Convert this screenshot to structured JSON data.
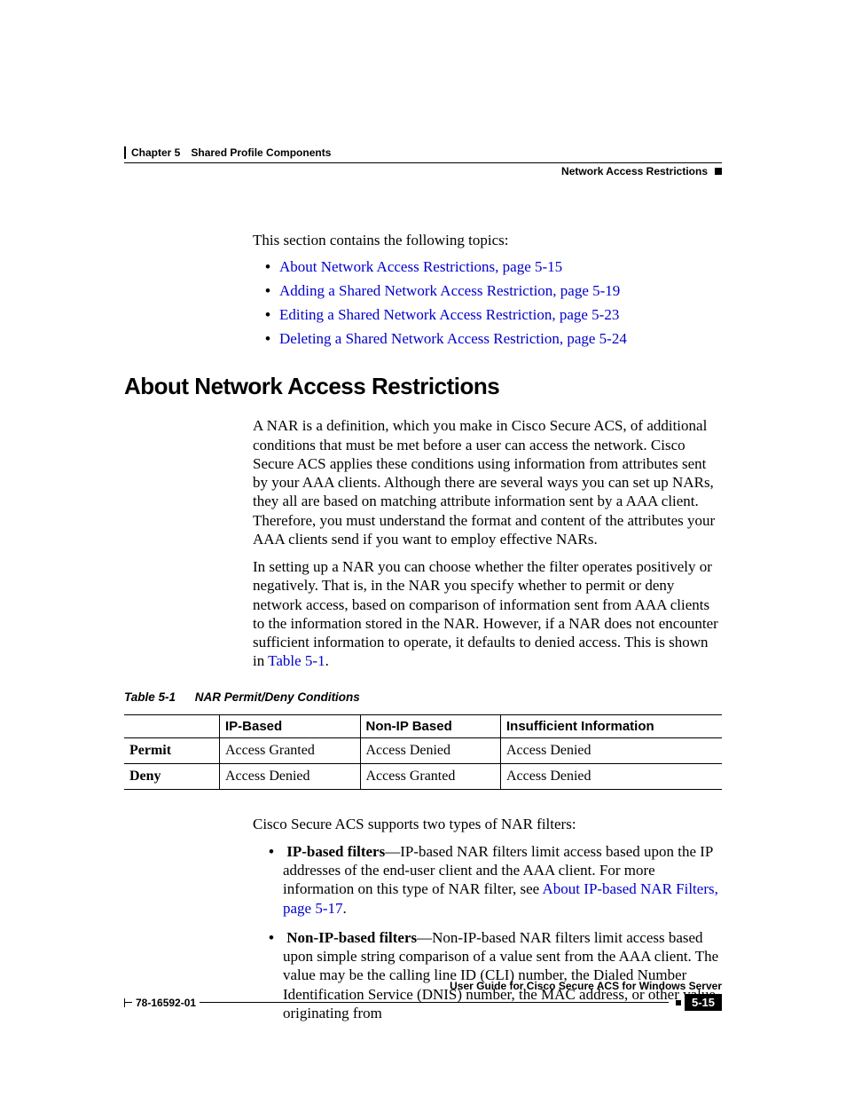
{
  "header": {
    "chapter": "Chapter 5",
    "chapter_title": "Shared Profile Components",
    "section_right": "Network Access Restrictions"
  },
  "intro": {
    "lead": "This section contains the following topics:",
    "links": [
      "About Network Access Restrictions, page 5-15",
      "Adding a Shared Network Access Restriction, page 5-19",
      "Editing a Shared Network Access Restriction, page 5-23",
      "Deleting a Shared Network Access Restriction, page 5-24"
    ]
  },
  "section": {
    "heading": "About Network Access Restrictions",
    "para1": "A NAR is a definition, which you make in Cisco Secure ACS, of additional conditions that must be met before a user can access the network. Cisco Secure ACS applies these conditions using information from attributes sent by your AAA clients. Although there are several ways you can set up NARs, they all are based on matching attribute information sent by a AAA client. Therefore, you must understand the format and content of the attributes your AAA clients send if you want to employ effective NARs.",
    "para2_a": "In setting up a NAR you can choose whether the filter operates positively or negatively. That is, in the NAR you specify whether to permit or deny network access, based on comparison of information sent from AAA clients to the information stored in the NAR. However, if a NAR does not encounter sufficient information to operate, it defaults to denied access. This is shown in ",
    "para2_link": "Table 5-1",
    "para2_b": "."
  },
  "table": {
    "caption_label": "Table 5-1",
    "caption_title": "NAR Permit/Deny Conditions",
    "headers": [
      "",
      "IP-Based",
      "Non-IP Based",
      "Insufficient Information"
    ],
    "rows": [
      [
        "Permit",
        "Access Granted",
        "Access Denied",
        "Access Denied"
      ],
      [
        "Deny",
        "Access Denied",
        "Access Granted",
        "Access Denied"
      ]
    ]
  },
  "after_table": {
    "lead": "Cisco Secure ACS supports two types of NAR filters:",
    "filters": [
      {
        "bold": "IP-based filters",
        "text_a": "—IP-based NAR filters limit access based upon the IP addresses of the end-user client and the AAA client. For more information on this type of NAR filter, see ",
        "link": "About IP-based NAR Filters, page 5-17",
        "text_b": "."
      },
      {
        "bold": "Non-IP-based filters",
        "text_a": "—Non-IP-based NAR filters limit access based upon simple string comparison of a value sent from the AAA client. The value may be the calling line ID (CLI) number, the Dialed Number Identification Service (DNIS) number, the MAC address, or other value originating from",
        "link": "",
        "text_b": ""
      }
    ]
  },
  "footer": {
    "guide": "User Guide for Cisco Secure ACS for Windows Server",
    "docnum": "78-16592-01",
    "pagenum": "5-15"
  }
}
